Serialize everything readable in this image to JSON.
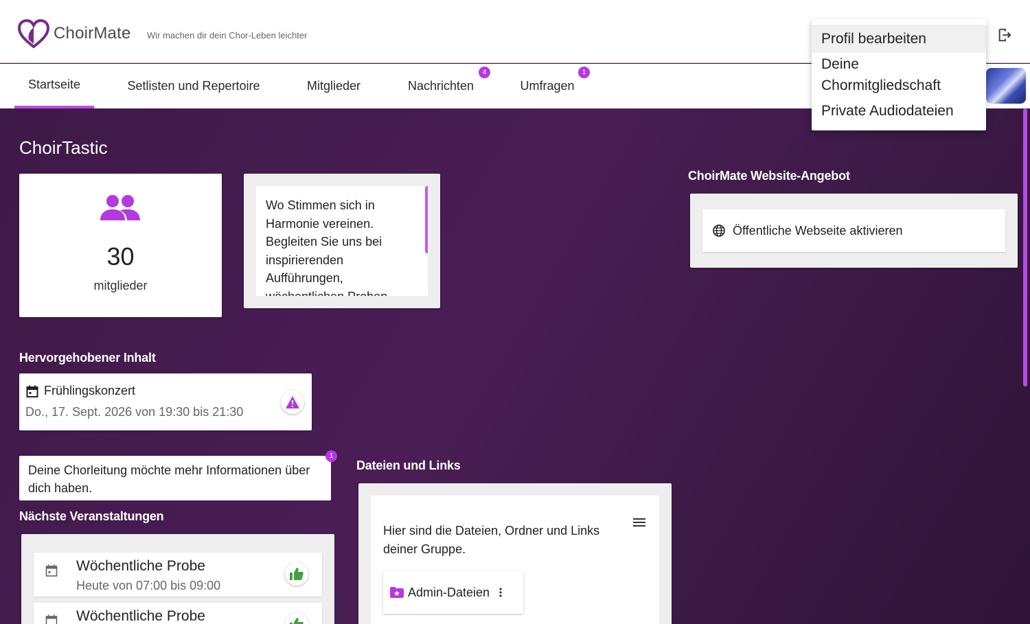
{
  "header": {
    "brand": "ChoirMate",
    "tagline": "Wir machen dir dein Chor-Leben leichter"
  },
  "nav": {
    "tabs": [
      {
        "label": "Startseite"
      },
      {
        "label": "Setlisten und Repertoire"
      },
      {
        "label": "Mitglieder"
      },
      {
        "label": "Nachrichten",
        "badge": "4"
      },
      {
        "label": "Umfragen",
        "badge": "1"
      }
    ]
  },
  "menu": {
    "items": [
      "Profil bearbeiten",
      "Deine Chormitgliedschaft",
      "Private Audiodateien"
    ]
  },
  "choir": {
    "name": "ChoirTastic",
    "members_count": "30",
    "members_label": "mitglieder",
    "description": "Wo Stimmen sich in Harmonie vereinen. Begleiten Sie uns bei inspirierenden Aufführungen, wöchentlichen Proben"
  },
  "website": {
    "title": "ChoirMate Website-Angebot",
    "activate_label": "Öffentliche Webseite aktivieren"
  },
  "featured": {
    "title": "Hervorgehobener Inhalt",
    "event_title": "Frühlingskonzert",
    "event_date": "Do., 17. Sept. 2026 von 19:30 bis 21:30"
  },
  "info": {
    "text": "Deine Chorleitung möchte mehr Informationen über dich haben.",
    "badge": "1"
  },
  "events": {
    "title": "Nächste Veranstaltungen",
    "items": [
      {
        "title": "Wöchentliche Probe",
        "date": "Heute von 07:00 bis 09:00"
      },
      {
        "title": "Wöchentliche Probe",
        "date": ""
      }
    ]
  },
  "files": {
    "title": "Dateien und Links",
    "text": "Hier sind die Dateien, Ordner und Links deiner Gruppe.",
    "folder_label": "Admin-Dateien"
  },
  "colors": {
    "accent": "#b23ae0",
    "background": "#3d1a45",
    "thumb_green": "#43a047"
  }
}
